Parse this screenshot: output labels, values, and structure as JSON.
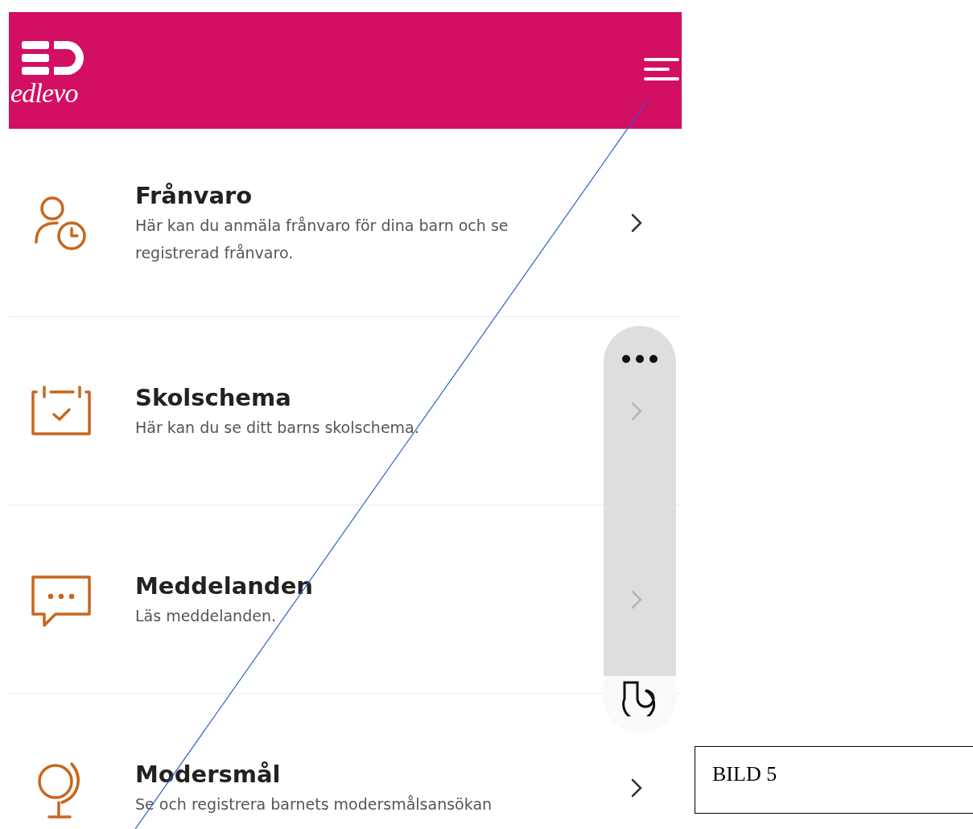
{
  "header": {
    "logo_text": "edlevo"
  },
  "menu_items": [
    {
      "kind": "absence",
      "title": "Frånvaro",
      "description": "Här kan du anmäla frånvaro för dina barn och se registrerad frånvaro."
    },
    {
      "kind": "schedule",
      "title": "Skolschema",
      "description": "Här kan du se ditt barns skolschema."
    },
    {
      "kind": "messages",
      "title": "Meddelanden",
      "description": "Läs meddelanden."
    },
    {
      "kind": "language",
      "title": "Modersmål",
      "description": "Se och registrera barnets modersmålsansökan"
    }
  ],
  "figure_label": "BILD 5"
}
